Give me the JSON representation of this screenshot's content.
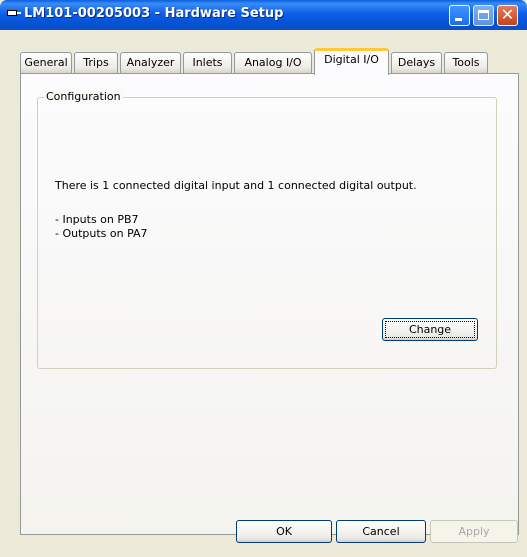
{
  "window": {
    "title": "LM101-00205003 - Hardware Setup"
  },
  "tabs": [
    {
      "label": "General"
    },
    {
      "label": "Trips"
    },
    {
      "label": "Analyzer"
    },
    {
      "label": "Inlets"
    },
    {
      "label": "Analog I/O"
    },
    {
      "label": "Digital I/O"
    },
    {
      "label": "Delays"
    },
    {
      "label": "Tools"
    }
  ],
  "active_tab": "Digital I/O",
  "configuration": {
    "group_title": "Configuration",
    "message": "There is 1 connected digital input and 1 connected digital output.",
    "inputs_line": "- Inputs on PB7",
    "outputs_line": "- Outputs on PA7",
    "change_label": "Change"
  },
  "footer": {
    "ok_label": "OK",
    "cancel_label": "Cancel",
    "apply_label": "Apply"
  },
  "colors": {
    "titlebar": "#0553d6",
    "close_button": "#c4411d",
    "active_tab_highlight": "#ffc83c",
    "dialog_background": "#ece9d8"
  }
}
